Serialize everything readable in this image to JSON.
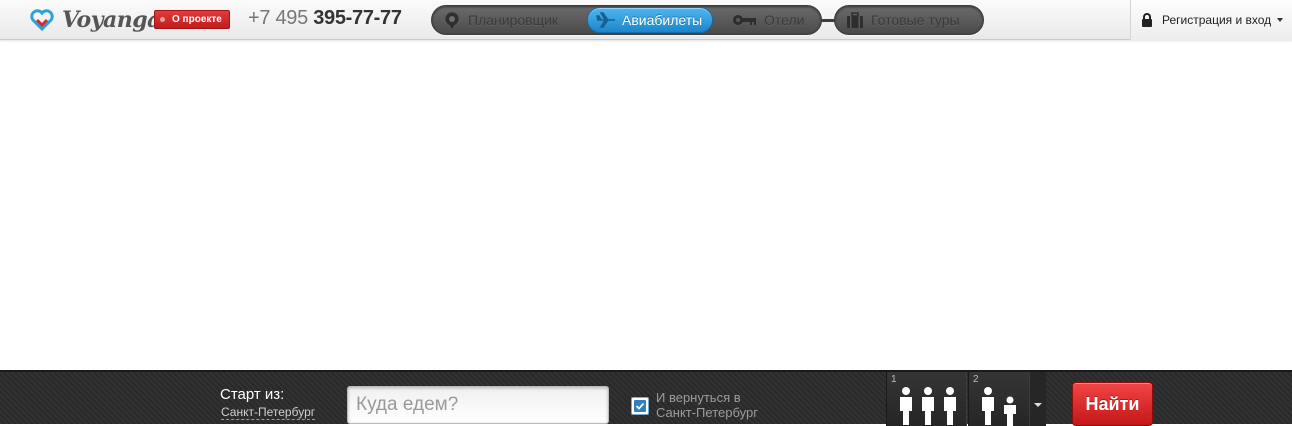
{
  "header": {
    "logo_text": "Voyanga",
    "about_label": "О проекте",
    "phone_prefix": "+7 495",
    "phone_number": "395-77-77",
    "nav": [
      {
        "label": "Планировщик",
        "icon": "map-pin-icon",
        "active": false
      },
      {
        "label": "Авиабилеты",
        "icon": "airplane-icon",
        "active": true
      },
      {
        "label": "Отели",
        "icon": "key-icon",
        "active": false
      },
      {
        "label": "Готовые туры",
        "icon": "suitcase-icon",
        "active": false
      }
    ],
    "auth_label": "Регистрация и вход"
  },
  "search": {
    "start_label": "Старт из:",
    "start_city": "Санкт-Петербург",
    "destination_placeholder": "Куда едем?",
    "return_checked": true,
    "return_line1": "И вернуться в",
    "return_line2": "Санкт-Петербург",
    "pax_groups": [
      {
        "number": "1",
        "adults": 3,
        "children": 0
      },
      {
        "number": "2",
        "adults": 1,
        "children": 1
      }
    ],
    "find_label": "Найти"
  },
  "colors": {
    "accent_red": "#d92525",
    "nav_active_blue": "#2a95d8",
    "searchbar_bg": "#2b2b2b"
  }
}
